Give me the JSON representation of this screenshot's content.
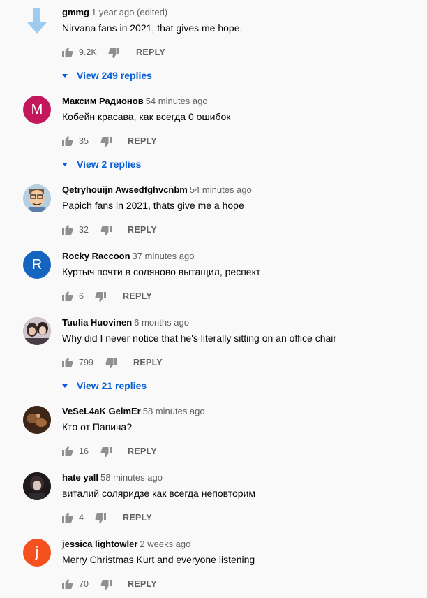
{
  "reply_label": "REPLY",
  "colors": {
    "link": "#065fd4",
    "muted": "#606060",
    "text": "#030303",
    "background": "#f9f9f9"
  },
  "comments": [
    {
      "author": "gmmg",
      "time": "1 year ago (edited)",
      "text": "Nirvana fans in 2021, that gives me hope.",
      "likes": "9.2K",
      "replies_label": "View 249 replies",
      "avatar_icon": "arrow-down-icon",
      "avatar_color": "#9ecbf0"
    },
    {
      "author": "Максим Радионов",
      "time": "54 minutes ago",
      "text": "Кобейн красава, как всегда 0 ошибок",
      "likes": "35",
      "replies_label": "View 2 replies",
      "avatar_letter": "М",
      "avatar_color": "#c2185b"
    },
    {
      "author": "Qetryhouijn Awsedfghvcnbm",
      "time": "54 minutes ago",
      "text": "Papich fans in 2021, thats give me a hope",
      "likes": "32",
      "avatar_icon": "cartoon-face-icon",
      "avatar_color": "#b3cfe0"
    },
    {
      "author": "Rocky Raccoon",
      "time": "37 minutes ago",
      "text": "Куртыч почти в соляново вытащил, респект",
      "likes": "6",
      "avatar_letter": "R",
      "avatar_color": "#1565c0"
    },
    {
      "author": "Tuulia Huovinen",
      "time": "6 months ago",
      "text": "Why did I never notice that he's literally sitting on an office chair",
      "likes": "799",
      "replies_label": "View 21 replies",
      "avatar_icon": "photo-avatar-icon",
      "avatar_color": "#8a7f8f"
    },
    {
      "author": "VeSeL4aK GelmEr",
      "time": "58 minutes ago",
      "text": "Кто от Папича?",
      "likes": "16",
      "avatar_icon": "photo-avatar-icon",
      "avatar_color": "#5a3a22"
    },
    {
      "author": "hate yall",
      "time": "58 minutes ago",
      "text": "виталий соляридзе как всегда неповторим",
      "likes": "4",
      "avatar_icon": "photo-avatar-icon",
      "avatar_color": "#2a2326"
    },
    {
      "author": "jessica lightowler",
      "time": "2 weeks ago",
      "text": "Merry Christmas Kurt and everyone listening",
      "likes": "70",
      "avatar_letter": "j",
      "avatar_color": "#f4511e"
    }
  ]
}
